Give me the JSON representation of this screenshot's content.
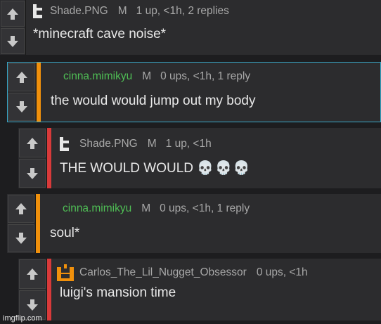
{
  "comments": [
    {
      "user": "Shade.PNG",
      "badge": "M",
      "meta": "1 up, <1h, 2 replies",
      "text": "*minecraft cave noise*",
      "avatar": "L-shape-avatar-icon",
      "stripe_color": "#3a3a3a",
      "user_color": "#a8a8a8"
    },
    {
      "user": "cinna.mimikyu",
      "badge": "M",
      "meta": "0 ups, <1h, 1 reply",
      "text": "the would would jump out my body",
      "stripe_color": "#f0900c",
      "user_color": "#4fbf55",
      "border_color": "#39a9c9"
    },
    {
      "user": "Shade.PNG",
      "badge": "M",
      "meta": "1 up, <1h",
      "text": "THE WOULD WOULD",
      "emoji": "💀💀💀",
      "stripe_color": "#d83a3a",
      "user_color": "#a8a8a8"
    },
    {
      "user": "cinna.mimikyu",
      "badge": "M",
      "meta": "0 ups, <1h, 1 reply",
      "text": "soul*",
      "stripe_color": "#f0900c",
      "user_color": "#4fbf55"
    },
    {
      "user": "Carlos_The_Lil_Nugget_Obsessor",
      "meta": "0 ups, <1h",
      "text": "luigi's mansion time",
      "stripe_color": "#d83a3a",
      "user_color": "#a8a8a8",
      "avatar": "orange-nugget-avatar-icon"
    }
  ],
  "watermark": "imgflip.com",
  "colors": {
    "background": "#1d1d1f",
    "panel": "#2c2c2e",
    "orange": "#f0900c",
    "red": "#d83a3a",
    "green": "#4fbf55",
    "blue_border": "#39a9c9"
  }
}
